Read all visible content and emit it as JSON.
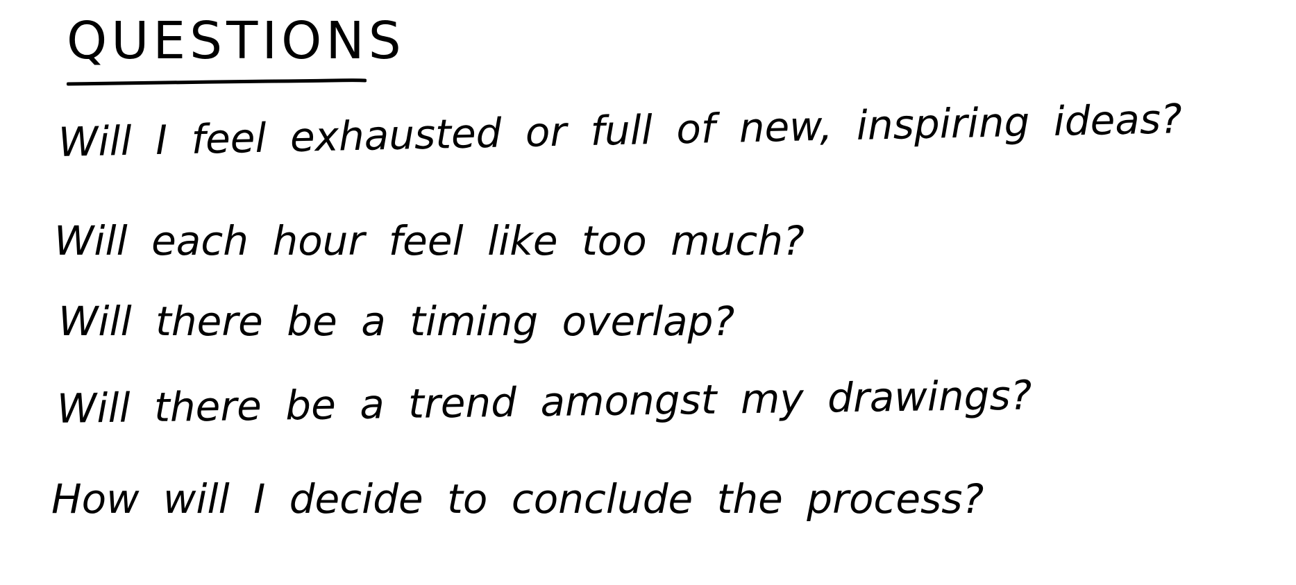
{
  "heading": "QUESTIONS",
  "questions": [
    "Will I feel exhausted or full of new, inspiring ideas?",
    "Will each hour feel like too much?",
    "Will there be a timing overlap?",
    "Will there be a trend amongst my drawings?",
    "How will I decide to conclude the process?"
  ],
  "colors": {
    "ink": "#000000",
    "paper": "#ffffff"
  }
}
